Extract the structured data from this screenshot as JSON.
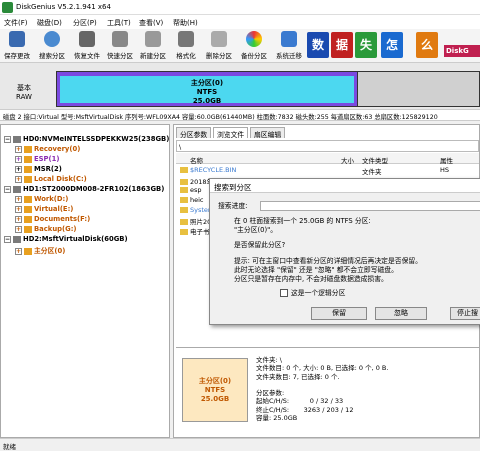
{
  "window": {
    "title": "DiskGenius V5.2.1.941 x64"
  },
  "menu": [
    "文件(F)",
    "磁盘(D)",
    "分区(P)",
    "工具(T)",
    "查看(V)",
    "帮助(H)"
  ],
  "toolbar": [
    "保存更改",
    "搜索分区",
    "恢复文件",
    "快速分区",
    "新建分区",
    "格式化",
    "删除分区",
    "备份分区",
    "系统迁移"
  ],
  "ad": {
    "chars": [
      "数",
      "据",
      "失",
      "怎",
      "么",
      "办"
    ],
    "colors": [
      "#1a4ab0",
      "#c02020",
      "#2a9a3a",
      "#1a6ad0",
      "#e07a10",
      "#c02020"
    ],
    "brand": "DiskG"
  },
  "disk_map": {
    "left_label_1": "基本",
    "left_label_2": "RAW",
    "part_name": "主分区(0)",
    "part_fs": "NTFS",
    "part_size": "25.0GB"
  },
  "info_line": "磁盘 2 接口:Virtual  型号:MsftVirtualDisk  序列号:WFL09XA4  容量:60.0GB(61440MB)  柱面数:7832  磁头数:255  每道扇区数:63  总扇区数:125829120",
  "tree": [
    {
      "label": "HD0:NVMeINTELSSDPEKKW25(238GB)",
      "kind": "disk",
      "color": "normal"
    },
    {
      "label": "Recovery(0)",
      "kind": "part",
      "color": "orange"
    },
    {
      "label": "ESP(1)",
      "kind": "part",
      "color": "purple"
    },
    {
      "label": "MSR(2)",
      "kind": "part",
      "color": "normal"
    },
    {
      "label": "Local Disk(C:)",
      "kind": "part",
      "color": "orange"
    },
    {
      "label": "HD1:ST2000DM008-2FR102(1863GB)",
      "kind": "disk",
      "color": "normal"
    },
    {
      "label": "Work(D:)",
      "kind": "part",
      "color": "orange"
    },
    {
      "label": "Virtual(E:)",
      "kind": "part",
      "color": "orange"
    },
    {
      "label": "Documents(F:)",
      "kind": "part",
      "color": "orange"
    },
    {
      "label": "Backup(G:)",
      "kind": "part",
      "color": "orange"
    },
    {
      "label": "HD2:MsftVirtualDisk(60GB)",
      "kind": "disk",
      "color": "normal"
    },
    {
      "label": "主分区(0)",
      "kind": "part",
      "color": "orange"
    }
  ],
  "tabs": [
    "分区参数",
    "浏览文件",
    "扇区编辑"
  ],
  "path": "\\",
  "columns": [
    "名称",
    "大小",
    "文件类型",
    "属性"
  ],
  "files": [
    {
      "name": "$RECYCLE.BIN",
      "type": "文件夹",
      "attr": "HS"
    },
    {
      "name": "2018年度...",
      "type": "文件夹",
      "attr": ""
    },
    {
      "name": "esp",
      "type": "",
      "attr": ""
    },
    {
      "name": "heic",
      "type": "",
      "attr": ""
    },
    {
      "name": "System...",
      "type": "",
      "attr": ""
    },
    {
      "name": "照片20...",
      "type": "",
      "attr": ""
    },
    {
      "name": "电子书",
      "type": "",
      "attr": ""
    }
  ],
  "bottom": {
    "part_name": "主分区(0)",
    "part_fs": "NTFS",
    "part_size": "25.0GB",
    "info": "文件夹: \\\n文件数目: 0 个, 大小: 0 B, 已选择: 0 个, 0 B.\n文件夹数目: 7, 已选择: 0 个.\n\n分区参数:\n起始C/H/S:          0 / 32 / 33\n终止C/H/S:       3263 / 203 / 12\n容量: 25.0GB"
  },
  "dialog": {
    "title": "搜索到分区",
    "progress_label": "搜索进度:",
    "line1": "在 0 柱面搜索到一个 25.0GB 的 NTFS 分区:",
    "line2": "\"主分区(0)\"。",
    "question": "是否保留此分区?",
    "hint1": "提示: 可在主窗口中查看新分区的详细情况后再决定是否保留。",
    "hint2": "此时无论选择 \"保留\" 还是 \"忽略\" 都不会立即写磁盘。",
    "hint3": "分区只是暂存在内存中, 不会对磁盘数据造成损害。",
    "checkbox": "这是一个逻辑分区",
    "btn_keep": "保留",
    "btn_ignore": "忽略",
    "btn_stop": "停止搜"
  },
  "status": "就绪"
}
